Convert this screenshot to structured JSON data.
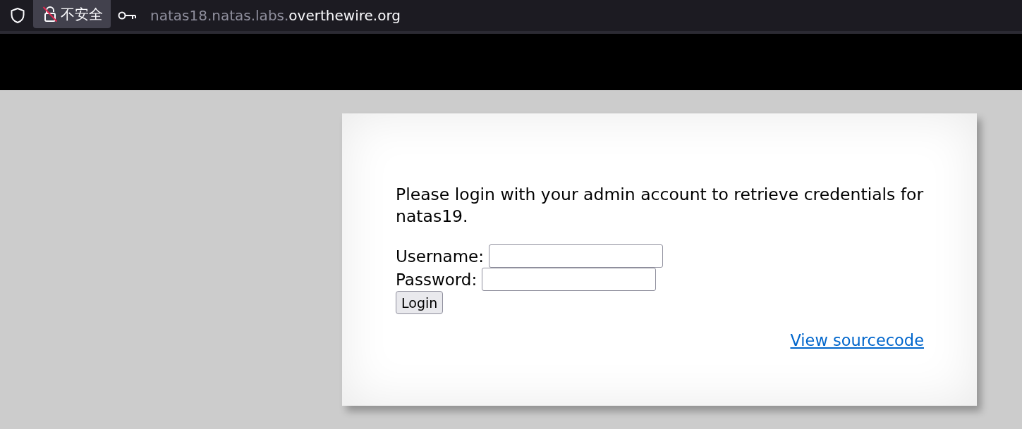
{
  "browser": {
    "security_label": "不安全",
    "url": {
      "subdomain": "natas18.natas.labs.",
      "domain": "overthewire.org"
    }
  },
  "page": {
    "message": "Please login with your admin account to retrieve credentials for natas19.",
    "fields": [
      {
        "label": "Username:"
      },
      {
        "label": "Password:"
      }
    ],
    "button": "Login",
    "link": "View sourcecode"
  }
}
